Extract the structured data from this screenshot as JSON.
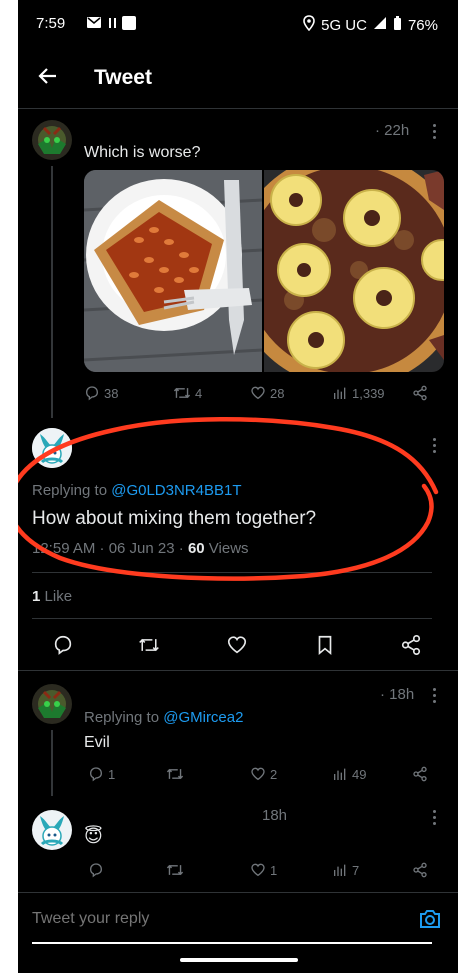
{
  "status_bar": {
    "time": "7:59",
    "network": "5G UC",
    "battery": "76%"
  },
  "header": {
    "title": "Tweet"
  },
  "tweet1": {
    "time": "· 22h",
    "text": "Which is worse?",
    "actions": {
      "replies": "38",
      "retweets": "4",
      "likes": "28",
      "views": "1,339"
    }
  },
  "main_tweet": {
    "replying_prefix": "Replying to",
    "replying_handle": "@G0LD3NR4BB1T",
    "text": "How about mixing them together?",
    "timestamp": "12:59 AM · 06 Jun 23 ·",
    "views_count": "60",
    "views_label": "Views",
    "likes_count": "1",
    "likes_label": "Like"
  },
  "reply1": {
    "time": "· 18h",
    "replying_prefix": "Replying to",
    "replying_handle": "@GMircea2",
    "text": "Evil",
    "actions": {
      "replies": "1",
      "retweets": "",
      "likes": "2",
      "views": "49"
    }
  },
  "reply2": {
    "time": "18h",
    "text": "😇",
    "actions": {
      "replies": "",
      "retweets": "",
      "likes": "1",
      "views": "7"
    }
  },
  "composer": {
    "placeholder": "Tweet your reply"
  },
  "colors": {
    "accent": "#1d9bf0",
    "annotation": "#ff3b1f"
  }
}
